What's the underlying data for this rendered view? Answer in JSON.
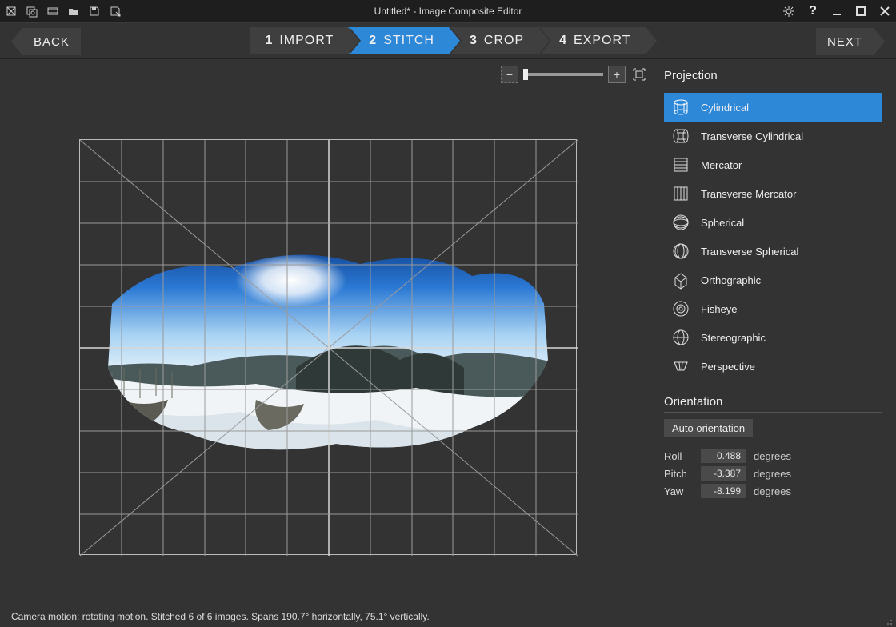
{
  "title": "Untitled* - Image Composite Editor",
  "nav": {
    "back": "BACK",
    "next": "NEXT"
  },
  "steps": [
    {
      "num": "1",
      "label": "IMPORT",
      "active": false
    },
    {
      "num": "2",
      "label": "STITCH",
      "active": true
    },
    {
      "num": "3",
      "label": "CROP",
      "active": false
    },
    {
      "num": "4",
      "label": "EXPORT",
      "active": false
    }
  ],
  "side": {
    "projection_title": "Projection",
    "projections": [
      {
        "label": "Cylindrical",
        "active": true
      },
      {
        "label": "Transverse Cylindrical",
        "active": false
      },
      {
        "label": "Mercator",
        "active": false
      },
      {
        "label": "Transverse Mercator",
        "active": false
      },
      {
        "label": "Spherical",
        "active": false
      },
      {
        "label": "Transverse Spherical",
        "active": false
      },
      {
        "label": "Orthographic",
        "active": false
      },
      {
        "label": "Fisheye",
        "active": false
      },
      {
        "label": "Stereographic",
        "active": false
      },
      {
        "label": "Perspective",
        "active": false
      }
    ],
    "orientation_title": "Orientation",
    "auto_label": "Auto orientation",
    "roll": {
      "label": "Roll",
      "value": "0.488",
      "unit": "degrees"
    },
    "pitch": {
      "label": "Pitch",
      "value": "-3.387",
      "unit": "degrees"
    },
    "yaw": {
      "label": "Yaw",
      "value": "-8.199",
      "unit": "degrees"
    }
  },
  "status": "Camera motion: rotating motion. Stitched 6 of 6 images. Spans 190.7° horizontally, 75.1° vertically.",
  "icons": {
    "new_project": "new-project-icon",
    "new_from_images": "new-from-images-icon",
    "new_from_video": "new-from-video-icon",
    "open": "open-icon",
    "save": "save-icon",
    "save_as": "save-as-icon",
    "settings": "gear-icon",
    "help": "help-icon",
    "minimize": "minimize-icon",
    "maximize": "maximize-icon",
    "close": "close-icon",
    "zoom_out": "zoom-out-icon",
    "zoom_in": "zoom-in-icon",
    "fit": "zoom-fit-icon"
  }
}
